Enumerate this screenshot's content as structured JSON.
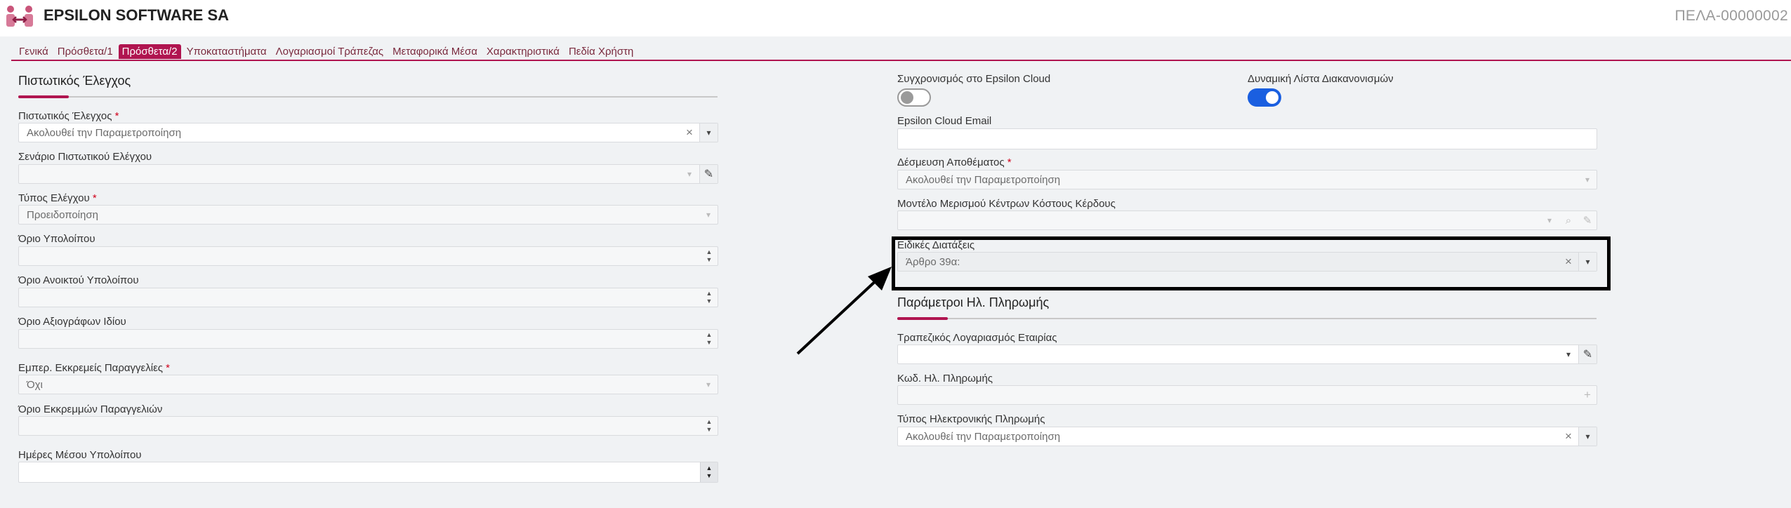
{
  "header": {
    "company": "EPSILON SOFTWARE SA",
    "doc_code": "ΠΕΛΑ-00000002",
    "logo_icon": "people-logo-icon"
  },
  "tabs": [
    {
      "label": "Γενικά",
      "active": false
    },
    {
      "label": "Πρόσθετα/1",
      "active": false
    },
    {
      "label": "Πρόσθετα/2",
      "active": true
    },
    {
      "label": "Υποκαταστήματα",
      "active": false
    },
    {
      "label": "Λογαριασμοί Τράπεζας",
      "active": false
    },
    {
      "label": "Μεταφορικά Μέσα",
      "active": false
    },
    {
      "label": "Χαρακτηριστικά",
      "active": false
    },
    {
      "label": "Πεδία Χρήστη",
      "active": false
    }
  ],
  "accent_color": "#b01550",
  "left": {
    "title": "Πιστωτικός Έλεγχος",
    "credit_check": {
      "label": "Πιστωτικός Έλεγχος",
      "required": "*",
      "value": "Ακολουθεί την Παραμετροποίηση"
    },
    "credit_scenario": {
      "label": "Σενάριο Πιστωτικού Ελέγχου",
      "value": ""
    },
    "check_type": {
      "label": "Τύπος Ελέγχου",
      "required": "*",
      "value": "Προειδοποίηση"
    },
    "balance_limit": {
      "label": "Όριο Υπολοίπου",
      "value": ""
    },
    "open_balance_limit": {
      "label": "Όριο Ανοικτού Υπολοίπου",
      "value": ""
    },
    "own_securities_limit": {
      "label": "Όριο Αξιογράφων Ιδίου",
      "value": ""
    },
    "pending_orders": {
      "label": "Εμπερ. Εκκρεμείς Παραγγελίες",
      "required": "*",
      "value": "Όχι"
    },
    "pending_orders_limit": {
      "label": "Όριο Εκκρεμμών Παραγγελιών",
      "value": ""
    },
    "avg_balance_days": {
      "label": "Ημέρες Μέσου Υπολοίπου",
      "value": ""
    }
  },
  "right": {
    "cloud_sync": {
      "label": "Συγχρονισμός στο Epsilon Cloud",
      "on": false
    },
    "dynamic_list": {
      "label": "Δυναμική Λίστα Διακανονισμών",
      "on": true
    },
    "cloud_email": {
      "label": "Epsilon Cloud Email",
      "value": ""
    },
    "stock_reservation": {
      "label": "Δέσμευση Αποθέματος",
      "required": "*",
      "value": "Ακολουθεί την Παραμετροποίηση"
    },
    "cost_center_model": {
      "label": "Μοντέλο Μερισμού Κέντρων Κόστους Κέρδους",
      "value": ""
    },
    "special_provisions": {
      "label": "Ειδικές Διατάξεις",
      "value": "Άρθρο 39α:"
    },
    "epay_title": "Παράμετροι Ηλ. Πληρωμής",
    "company_bank_account": {
      "label": "Τραπεζικός Λογαριασμός Εταιρίας",
      "value": ""
    },
    "epay_code": {
      "label": "Κωδ. Ηλ. Πληρωμής",
      "value": ""
    },
    "epay_type": {
      "label": "Τύπος Ηλεκτρονικής Πληρωμής",
      "value": "Ακολουθεί την Παραμετροποίηση"
    }
  },
  "icons": {
    "clear": "×",
    "caret": "▾",
    "edit": "✎",
    "search": "⌕",
    "plus": "+",
    "spin_up": "▲",
    "spin_down": "▼"
  }
}
